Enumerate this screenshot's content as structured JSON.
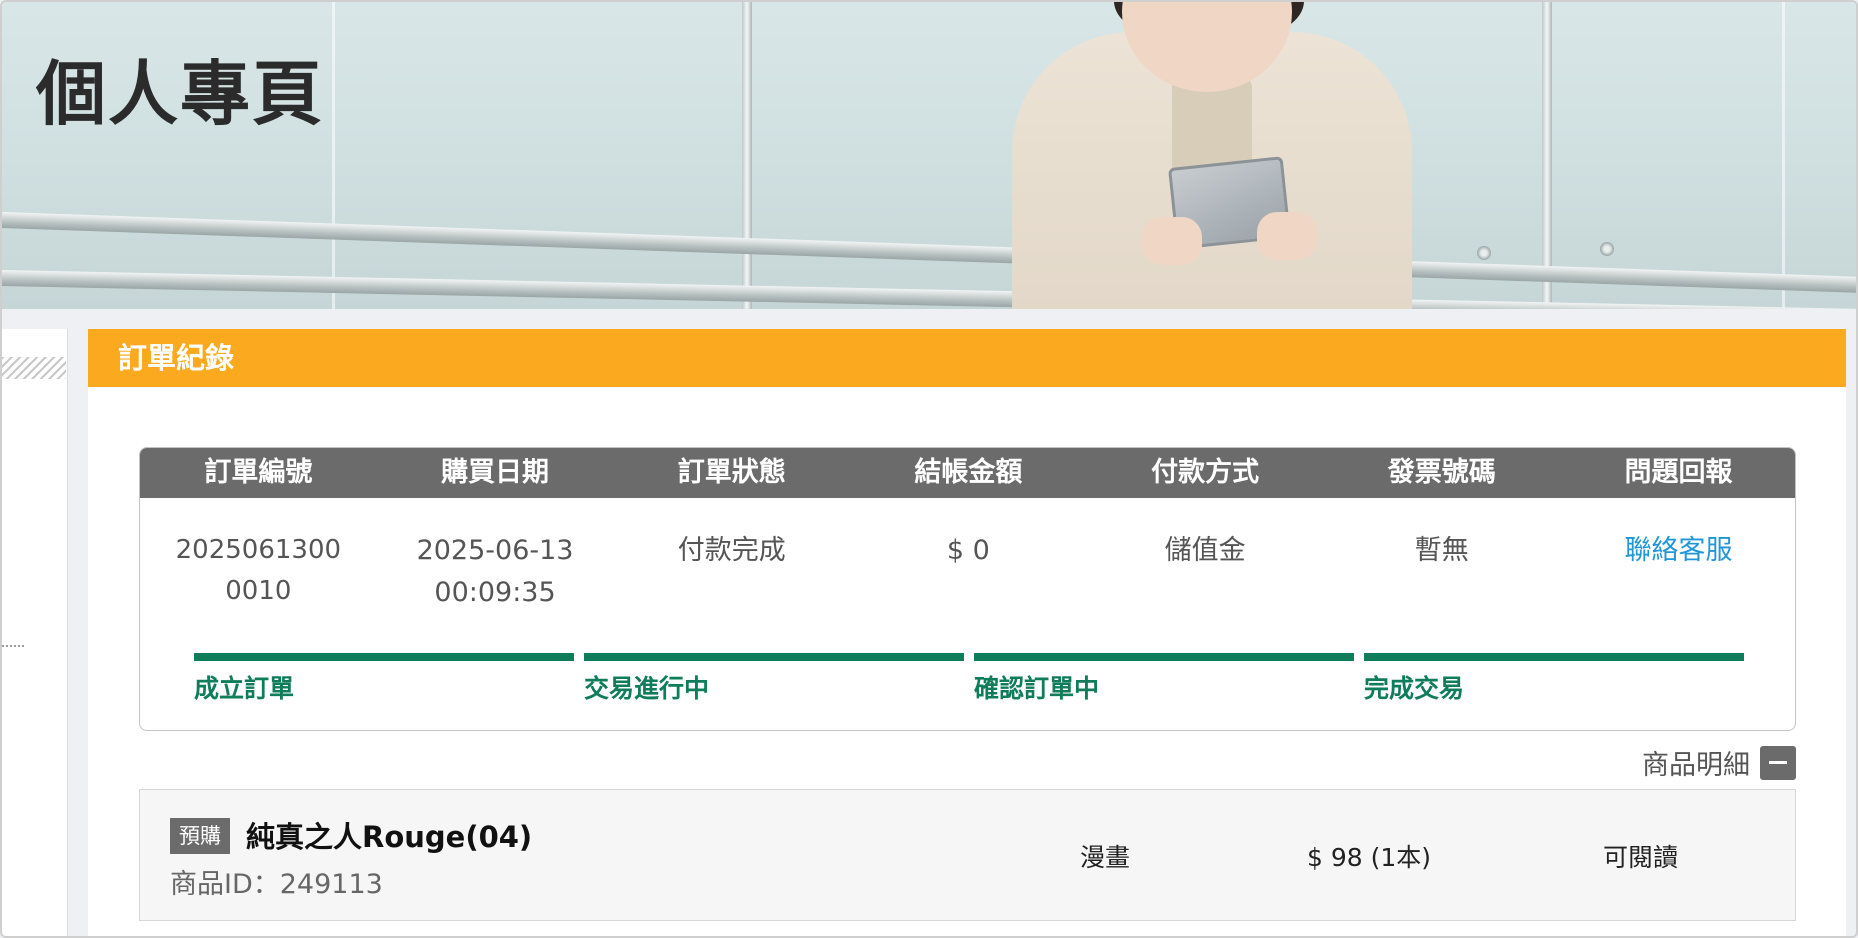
{
  "page": {
    "title": "個人專頁"
  },
  "section": {
    "title": "訂單紀錄"
  },
  "order": {
    "headers": [
      "訂單編號",
      "購買日期",
      "訂單狀態",
      "結帳金額",
      "付款方式",
      "發票號碼",
      "問題回報"
    ],
    "order_no_line1": "2025061300",
    "order_no_line2": "0010",
    "date": "2025-06-13",
    "time": "00:09:35",
    "status": "付款完成",
    "amount": "$ 0",
    "payment": "儲值金",
    "invoice": "暫無",
    "contact_link": "聯絡客服",
    "progress_steps": [
      "成立訂單",
      "交易進行中",
      "確認訂單中",
      "完成交易"
    ]
  },
  "details": {
    "toggle_label": "商品明細",
    "toggle_icon": "minus-icon"
  },
  "product": {
    "badge": "預購",
    "name": "純真之人Rouge(04)",
    "id_text": "商品ID：249113",
    "category": "漫畫",
    "price": "$ 98 (1本)",
    "availability": "可閱讀"
  },
  "colors": {
    "header_orange": "#fbaa1f",
    "progress_green": "#0f7c5a",
    "link_blue": "#2196d8",
    "table_header_gray": "#6b6b6b"
  }
}
